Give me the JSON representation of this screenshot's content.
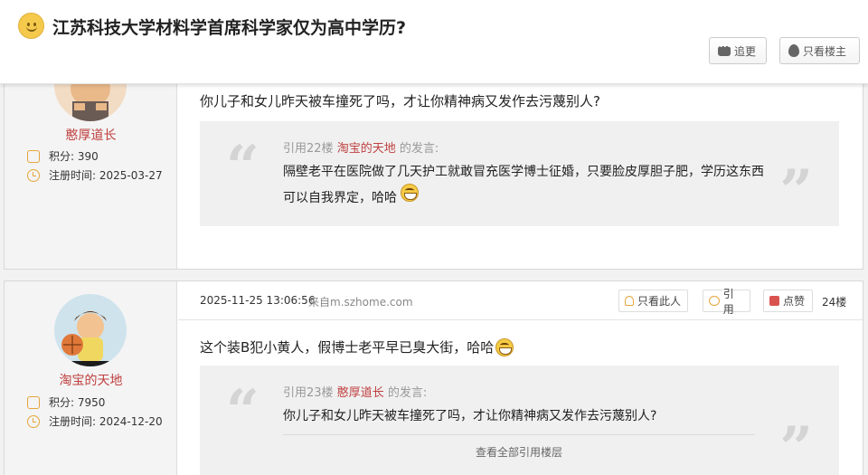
{
  "header": {
    "title": "江苏科技大学材料学首席科学家仅为高中学历?",
    "follow_label": "追更",
    "author_only_label": "只看楼主"
  },
  "posts": [
    {
      "username": "憨厚道长",
      "points_label": "积分:",
      "points": "390",
      "reg_label": "注册时间:",
      "reg_date": "2025-03-27",
      "content": "你儿子和女儿昨天被车撞死了吗，才让你精神病又发作去污蔑别人?",
      "quote": {
        "prefix": "引用22楼",
        "quoted_user": "淘宝的天地",
        "suffix": "的发言:",
        "text": "隔壁老平在医院做了几天护工就敢冒充医学博士征婚，只要脸皮厚胆子肥，学历这东西可以自我界定，哈哈"
      }
    },
    {
      "username": "淘宝的天地",
      "points_label": "积分:",
      "points": "7950",
      "reg_label": "注册时间:",
      "reg_date": "2024-12-20",
      "date": "2025-11-25 13:06:56",
      "source": "来自m.szhome.com",
      "only_label": "只看此人",
      "quote_label": "引用",
      "like_label": "点赞",
      "floor": "24楼",
      "content": "这个装B犯小黄人，假博士老平早已臭大街，哈哈",
      "quote": {
        "prefix": "引用23楼",
        "quoted_user": "憨厚道长",
        "suffix": "的发言:",
        "text": "你儿子和女儿昨天被车撞死了吗，才让你精神病又发作去污蔑别人?",
        "more_label": "查看全部引用楼层"
      }
    }
  ],
  "colors": {
    "username": "#c04040",
    "accent_icon": "#e6a53c",
    "like": "#d9534f"
  }
}
